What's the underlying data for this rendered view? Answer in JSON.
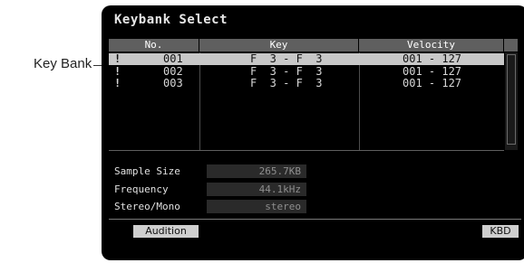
{
  "callout": {
    "label": "Key Bank"
  },
  "window": {
    "title": "Keybank Select"
  },
  "table": {
    "headers": {
      "no": "No.",
      "key": "Key",
      "velocity": "Velocity"
    },
    "rows": [
      {
        "mark": "!",
        "no": "001",
        "key": "F  3 - F  3",
        "velocity": "001 - 127",
        "selected": true
      },
      {
        "mark": "!",
        "no": "002",
        "key": "F  3 - F  3",
        "velocity": "001 - 127",
        "selected": false
      },
      {
        "mark": "!",
        "no": "003",
        "key": "F  3 - F  3",
        "velocity": "001 - 127",
        "selected": false
      }
    ]
  },
  "info": {
    "sample_size": {
      "label": "Sample Size",
      "value": "265.7KB"
    },
    "frequency": {
      "label": "Frequency",
      "value": "44.1kHz"
    },
    "stereo_mono": {
      "label": "Stereo/Mono",
      "value": "stereo"
    }
  },
  "buttons": {
    "audition": "Audition",
    "kbd": "KBD"
  }
}
